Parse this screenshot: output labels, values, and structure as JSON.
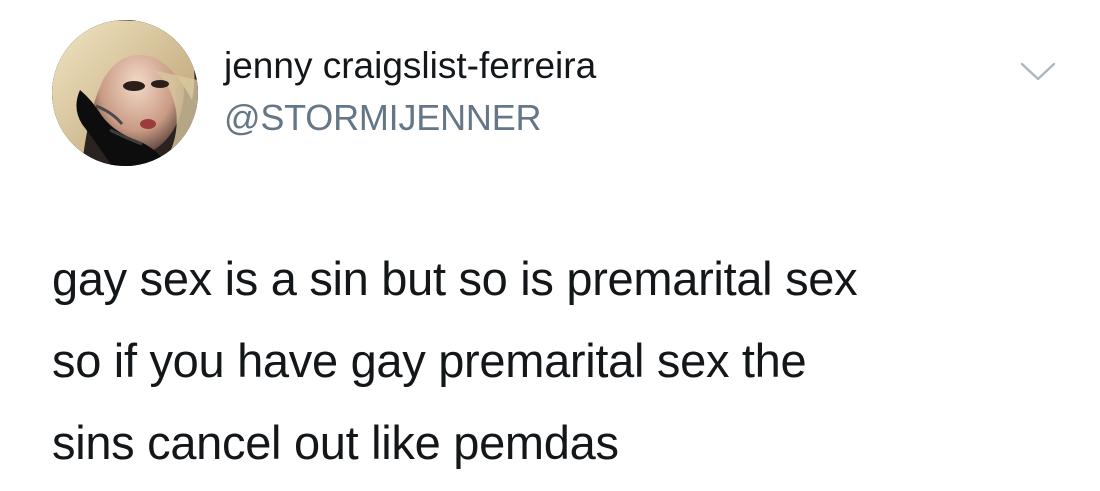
{
  "user": {
    "display_name": "jenny craigslist-ferreira",
    "handle": "@STORMIJENNER",
    "avatar_icon": "profile-photo",
    "menu_icon": "chevron-down-icon"
  },
  "tweet": {
    "lines": [
      "gay sex is a sin but so is premarital sex",
      "so if you have gay premarital sex the",
      "sins cancel out like pemdas"
    ]
  },
  "colors": {
    "text": "#14171a",
    "secondary": "#657786",
    "caret": "#aab8c2",
    "background": "#ffffff"
  }
}
